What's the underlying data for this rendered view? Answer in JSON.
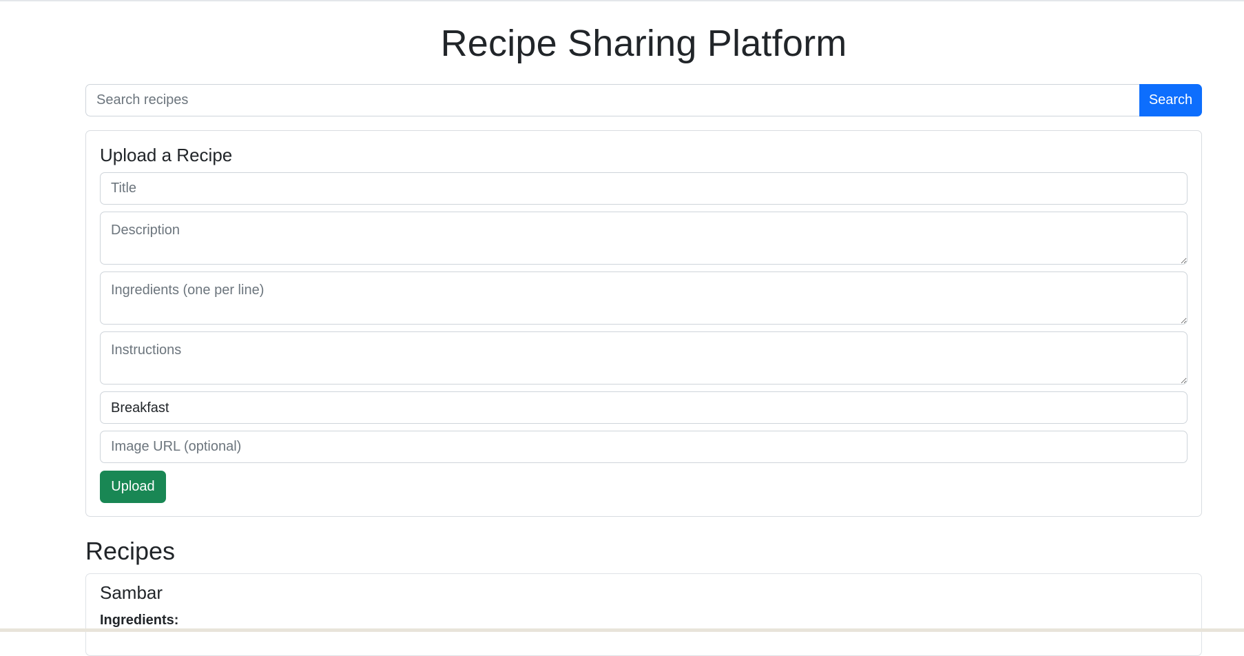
{
  "page": {
    "title": "Recipe Sharing Platform"
  },
  "search": {
    "placeholder": "Search recipes",
    "button_label": "Search"
  },
  "upload_form": {
    "heading": "Upload a Recipe",
    "title_placeholder": "Title",
    "description_placeholder": "Description",
    "ingredients_placeholder": "Ingredients (one per line)",
    "instructions_placeholder": "Instructions",
    "category_selected": "Breakfast",
    "image_url_placeholder": "Image URL (optional)",
    "upload_label": "Upload"
  },
  "recipes": {
    "heading": "Recipes",
    "items": [
      {
        "title": "Sambar",
        "ingredients_label": "Ingredients:"
      }
    ]
  },
  "colors": {
    "primary": "#0d6efd",
    "success": "#198754",
    "text": "#212529",
    "placeholder": "#6c757d",
    "border": "#ced4da"
  }
}
